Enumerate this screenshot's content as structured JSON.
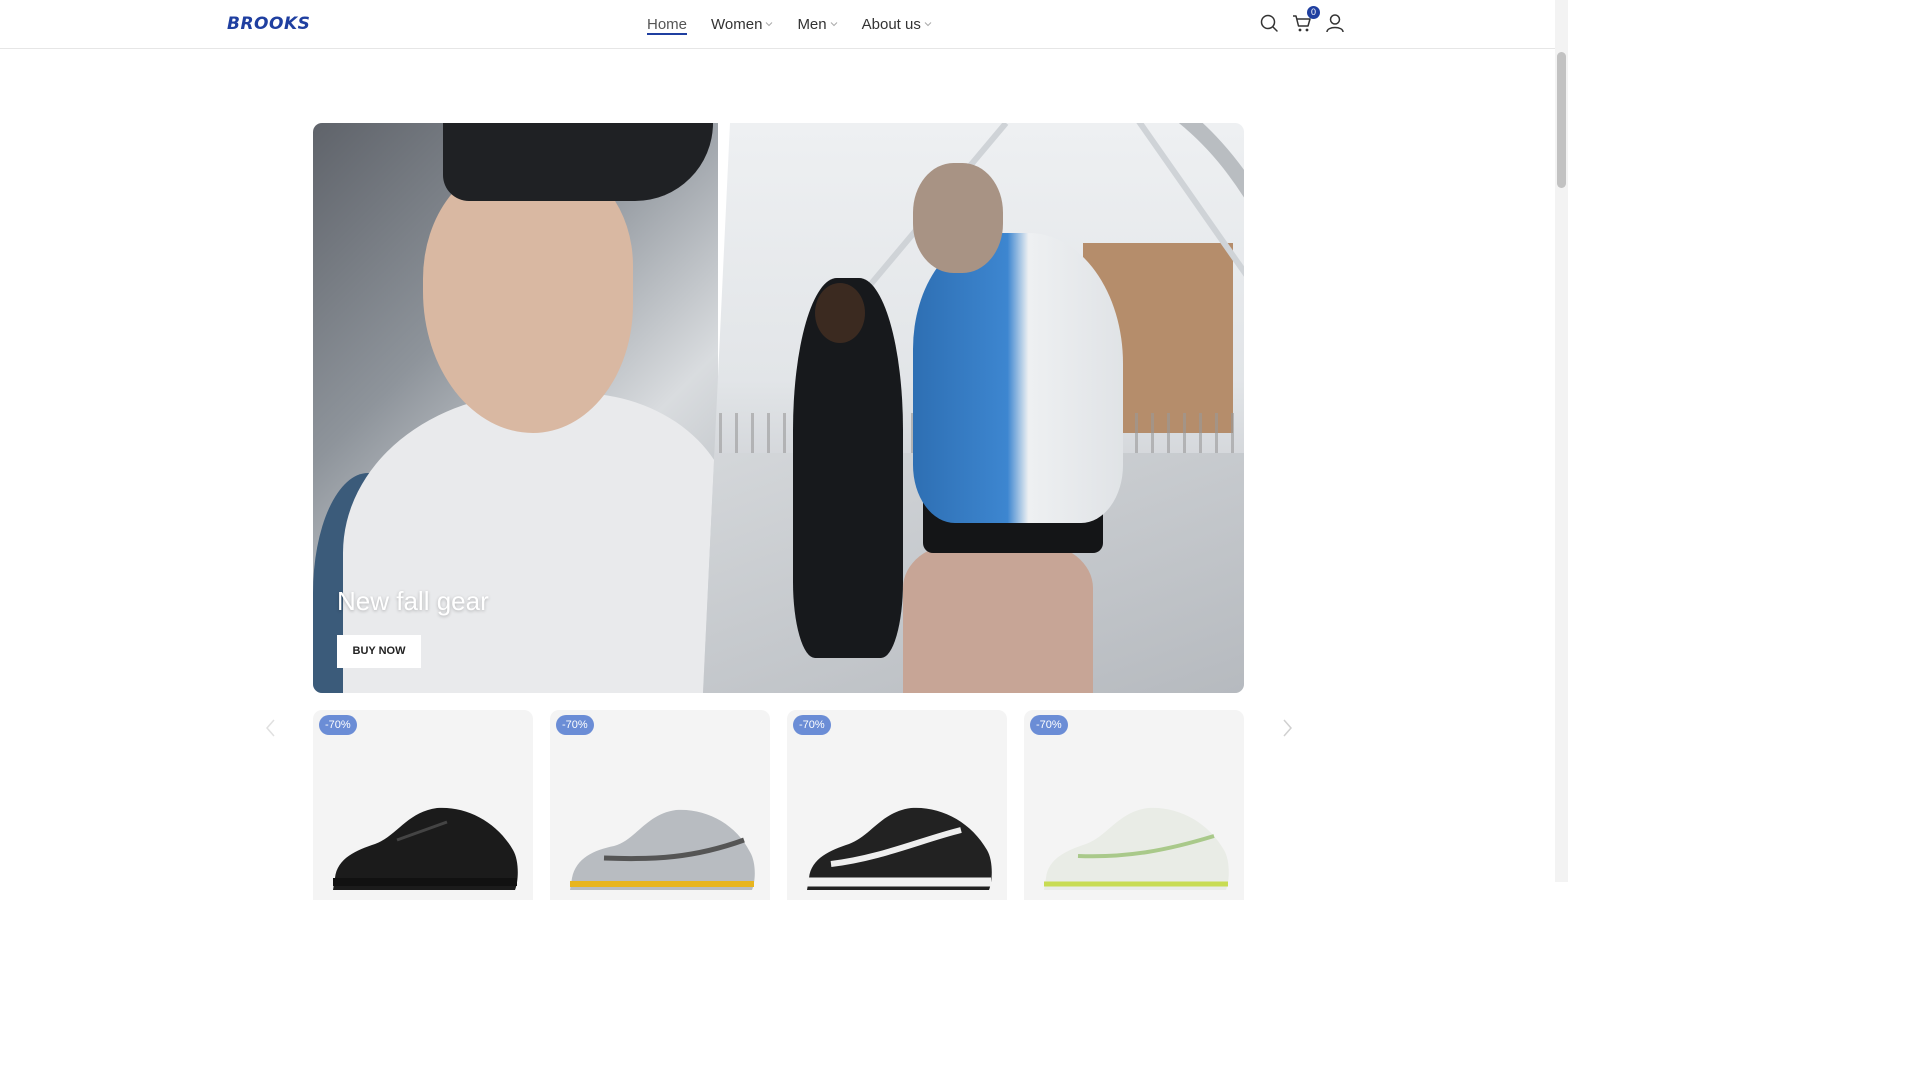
{
  "header": {
    "logo": "BROOKS",
    "nav": [
      {
        "label": "Home",
        "active": true,
        "dropdown": false
      },
      {
        "label": "Women",
        "active": false,
        "dropdown": true
      },
      {
        "label": "Men",
        "active": false,
        "dropdown": true
      },
      {
        "label": "About us",
        "active": false,
        "dropdown": true
      }
    ],
    "cart_count": "0",
    "icons": [
      "search-icon",
      "cart-icon",
      "user-icon"
    ]
  },
  "hero": {
    "title": "New fall gear",
    "button": "BUY NOW"
  },
  "products": [
    {
      "discount": "-70%",
      "shoe_color": "black"
    },
    {
      "discount": "-70%",
      "shoe_color": "grey-yellow"
    },
    {
      "discount": "-70%",
      "shoe_color": "black-white"
    },
    {
      "discount": "-70%",
      "shoe_color": "white-lime"
    }
  ],
  "colors": {
    "brand": "#1f3fa0",
    "sale_badge": "#6b8dd6"
  }
}
